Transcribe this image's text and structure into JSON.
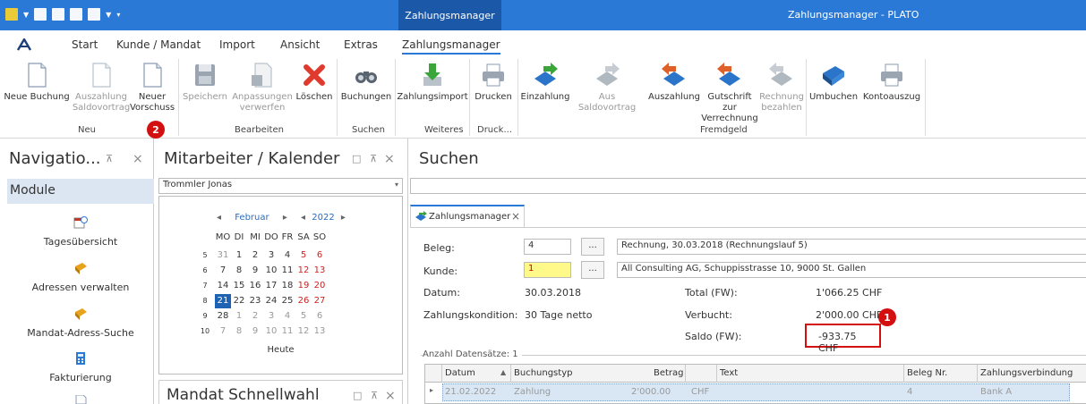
{
  "window": {
    "context_tab": "Zahlungsmanager",
    "title": "Zahlungsmanager - PLATO"
  },
  "menu_tabs": [
    "Start",
    "Kunde / Mandat",
    "Import",
    "Ansicht",
    "Extras",
    "Zahlungsmanager"
  ],
  "ribbon": {
    "neue_buchung": "Neue Buchung",
    "auszahlung_saldo_1": "Auszahlung",
    "auszahlung_saldo_2": "Saldovortrag",
    "neuer_vorschuss_1": "Neuer",
    "neuer_vorschuss_2": "Vorschuss",
    "speichern": "Speichern",
    "anpassungen_1": "Anpassungen",
    "anpassungen_2": "verwerfen",
    "loeschen": "Löschen",
    "buchungen": "Buchungen",
    "zahlungsimport": "Zahlungsimport",
    "drucken": "Drucken",
    "einzahlung": "Einzahlung",
    "aus_saldovortrag": "Aus Saldovortrag",
    "auszahlung": "Auszahlung",
    "gutschrift_1": "Gutschrift zur",
    "gutschrift_2": "Verrechnung",
    "rechnung_1": "Rechnung",
    "rechnung_2": "bezahlen",
    "umbuchen": "Umbuchen",
    "kontoauszug": "Kontoauszug",
    "groups": {
      "neu": "Neu",
      "bearbeiten": "Bearbeiten",
      "suchen": "Suchen",
      "weiteres": "Weiteres",
      "druck": "Druck...",
      "fremdgeld": "Fremdgeld"
    }
  },
  "nav": {
    "title": "Navigatio...",
    "pin": "⊼",
    "close": "×",
    "section": "Module",
    "items": [
      "Tagesübersicht",
      "Adressen verwalten",
      "Mandat-Adress-Suche",
      "Fakturierung"
    ]
  },
  "calendar_panel": {
    "title": "Mitarbeiter / Kalender",
    "employee": "Trommler Jonas",
    "month": "Februar",
    "year": "2022",
    "weekdays": [
      "MO",
      "DI",
      "MI",
      "DO",
      "FR",
      "SA",
      "SO"
    ],
    "weeks": [
      {
        "kw": "5",
        "days": [
          "31",
          "1",
          "2",
          "3",
          "4",
          "5",
          "6"
        ]
      },
      {
        "kw": "6",
        "days": [
          "7",
          "8",
          "9",
          "10",
          "11",
          "12",
          "13"
        ]
      },
      {
        "kw": "7",
        "days": [
          "14",
          "15",
          "16",
          "17",
          "18",
          "19",
          "20"
        ]
      },
      {
        "kw": "8",
        "days": [
          "21",
          "22",
          "23",
          "24",
          "25",
          "26",
          "27"
        ]
      },
      {
        "kw": "9",
        "days": [
          "28",
          "1",
          "2",
          "3",
          "4",
          "5",
          "6"
        ]
      },
      {
        "kw": "10",
        "days": [
          "7",
          "8",
          "9",
          "10",
          "11",
          "12",
          "13"
        ]
      }
    ],
    "today_label": "Heute",
    "selected_day": "21",
    "second_panel_title": "Mandat Schnellwahl"
  },
  "search_panel": {
    "title": "Suchen",
    "doc_tab": "Zahlungsmanager",
    "beleg_label": "Beleg:",
    "beleg_value": "4",
    "beleg_desc": "Rechnung, 30.03.2018 (Rechnungslauf 5)",
    "kunde_label": "Kunde:",
    "kunde_value": "1",
    "kunde_desc": "All Consulting AG, Schuppisstrasse 10, 9000 St. Gallen",
    "dots": "...",
    "datum_label": "Datum:",
    "datum_value": "30.03.2018",
    "kondition_label": "Zahlungskondition:",
    "kondition_value": "30 Tage netto",
    "total_label": "Total (FW):",
    "total_value": "1'066.25 CHF",
    "verbucht_label": "Verbucht:",
    "verbucht_value": "2'000.00 CHF",
    "saldo_label": "Saldo (FW):",
    "saldo_value": "-933.75 CHF",
    "anzahl": "Anzahl Datensätze: 1"
  },
  "table": {
    "headers": [
      "Datum",
      "Buchungstyp",
      "Betrag",
      "Text",
      "Beleg Nr.",
      "Zahlungsverbindung"
    ],
    "row": {
      "datum": "21.02.2022",
      "typ": "Zahlung",
      "betrag": "2'000.00",
      "waehrung": "CHF",
      "text": "",
      "beleg": "4",
      "verbindung": "Bank A"
    }
  },
  "badges": {
    "one": "1",
    "two": "2"
  },
  "colors": {
    "accent": "#2b79d7",
    "context": "#1c58a8",
    "highlight_red": "#d40f0f"
  }
}
